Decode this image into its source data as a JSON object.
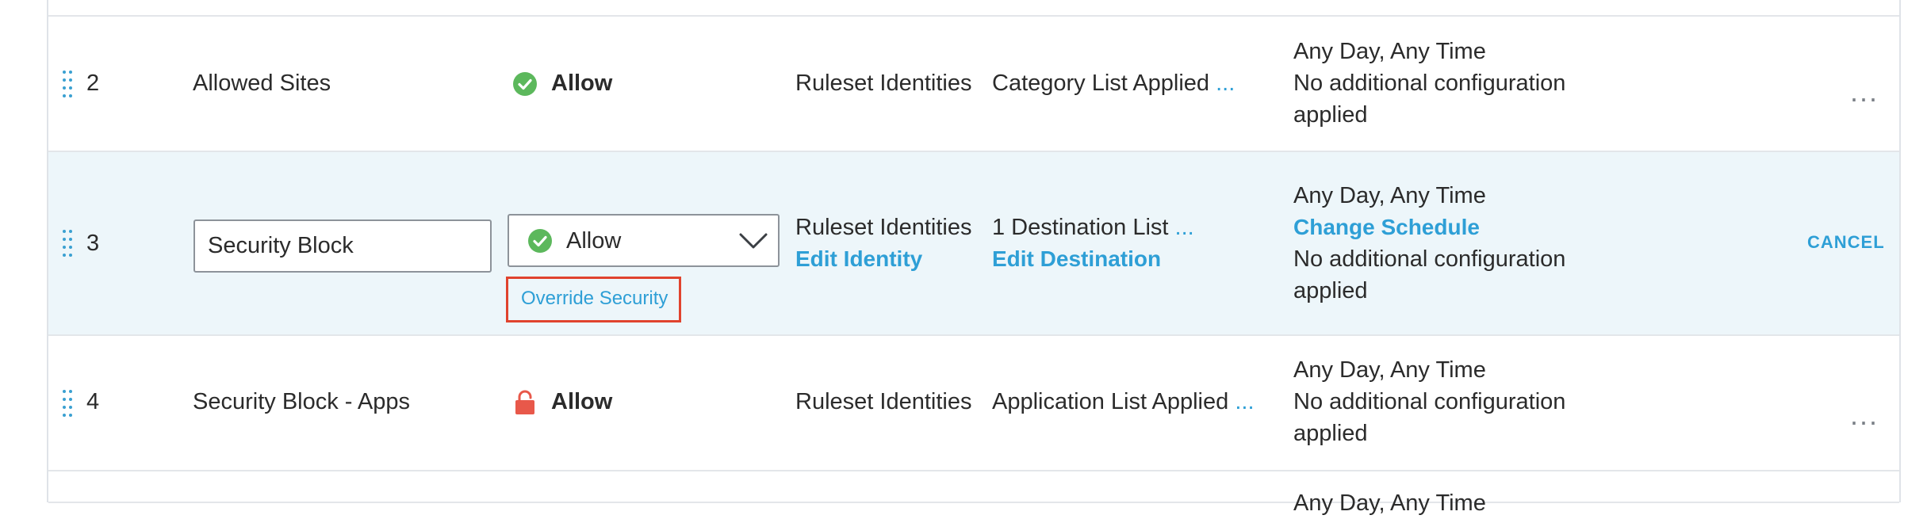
{
  "rows": [
    {
      "number": "2",
      "name": "Allowed Sites",
      "action": "Allow",
      "action_icon": "green-check-circle-icon",
      "identities": "Ruleset Identities",
      "destinations": "Category List Applied",
      "destinations_more": "...",
      "schedule": "Any Day, Any Time",
      "config_line1": "No additional configuration",
      "config_line2": "applied",
      "menu": "..."
    },
    {
      "number": "3",
      "name_value": "Security Block",
      "action_selected": "Allow",
      "action_icon": "green-check-circle-icon",
      "override_link": "Override Security",
      "identities": "Ruleset Identities",
      "edit_identity": "Edit Identity",
      "destinations": "1 Destination List",
      "destinations_more": "...",
      "edit_destination": "Edit Destination",
      "schedule": "Any Day, Any Time",
      "change_schedule": "Change Schedule",
      "config_line1": "No additional configuration",
      "config_line2": "applied",
      "cancel": "CANCEL"
    },
    {
      "number": "4",
      "name": "Security Block - Apps",
      "action": "Allow",
      "action_icon": "red-unlocked-padlock-icon",
      "identities": "Ruleset Identities",
      "destinations": "Application List Applied",
      "destinations_more": "...",
      "schedule": "Any Day, Any Time",
      "config_line1": "No additional configuration",
      "config_line2": "applied",
      "menu": "..."
    },
    {
      "schedule": "Any Day, Any Time"
    }
  ],
  "colors": {
    "accent": "#2e9fd6",
    "allow_green": "#5cb85c",
    "unlock_red": "#e8584a",
    "highlight_box": "#e0432e",
    "selected_row_bg": "#edf6fa"
  }
}
